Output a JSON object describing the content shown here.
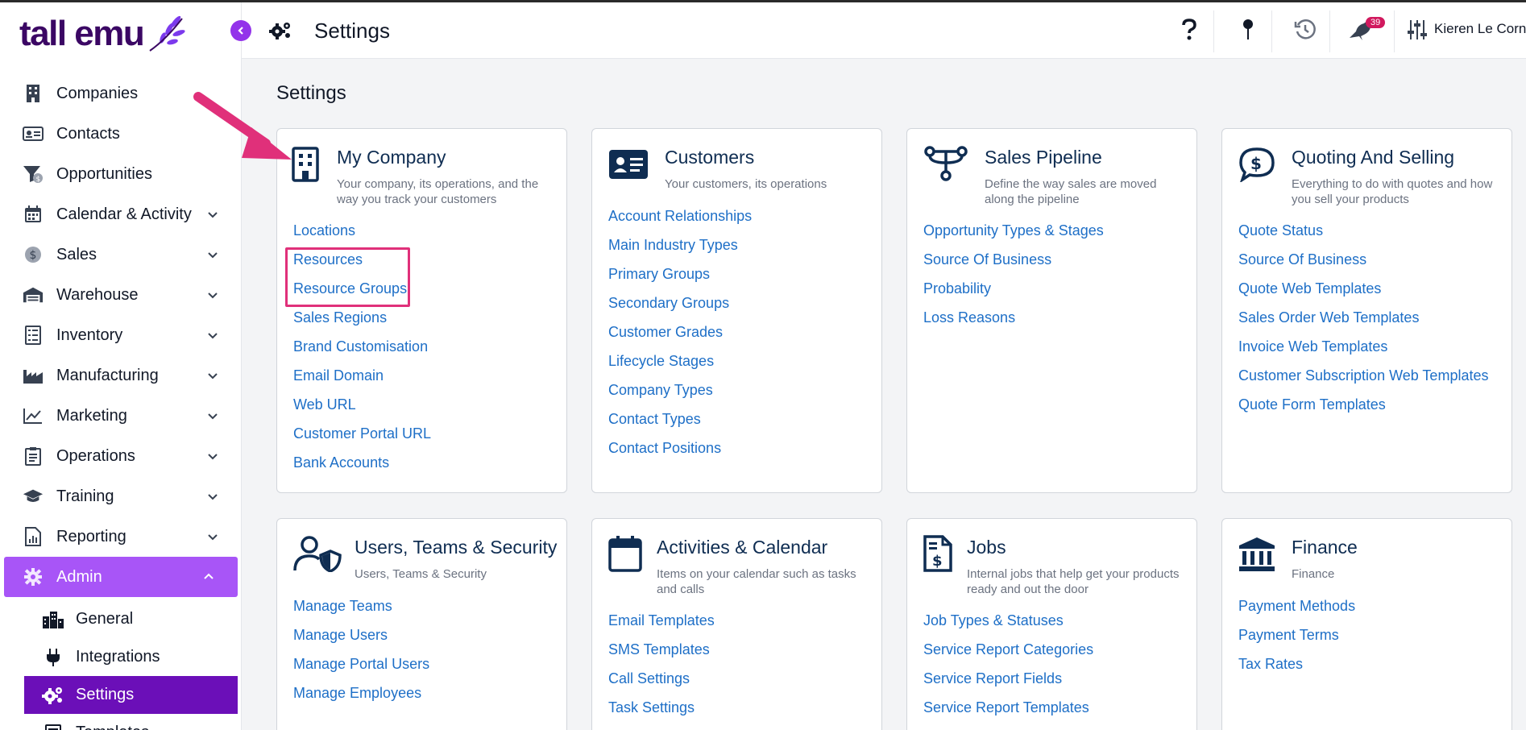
{
  "app": {
    "logo_text": "tall emu",
    "brand_color": "#3b0764",
    "accent_color": "#a855f7"
  },
  "sidebar": {
    "items": [
      {
        "label": "Companies",
        "icon": "building-icon"
      },
      {
        "label": "Contacts",
        "icon": "contact-card-icon"
      },
      {
        "label": "Opportunities",
        "icon": "funnel-icon"
      },
      {
        "label": "Calendar & Activity",
        "icon": "calendar-icon"
      },
      {
        "label": "Sales",
        "icon": "dollar-icon"
      },
      {
        "label": "Warehouse",
        "icon": "warehouse-icon"
      },
      {
        "label": "Inventory",
        "icon": "list-icon"
      },
      {
        "label": "Manufacturing",
        "icon": "factory-icon"
      },
      {
        "label": "Marketing",
        "icon": "chart-line-icon"
      },
      {
        "label": "Operations",
        "icon": "clipboard-icon"
      },
      {
        "label": "Training",
        "icon": "graduation-cap-icon"
      },
      {
        "label": "Reporting",
        "icon": "report-icon"
      },
      {
        "label": "Admin",
        "icon": "cog-icon"
      }
    ],
    "admin_sub": [
      {
        "label": "General",
        "icon": "city-icon"
      },
      {
        "label": "Integrations",
        "icon": "plug-icon"
      },
      {
        "label": "Settings",
        "icon": "cogs-icon"
      },
      {
        "label": "Templates",
        "icon": "template-icon"
      }
    ]
  },
  "topbar": {
    "title": "Settings",
    "notification_count": "39",
    "user_name": "Kieren Le Cornu"
  },
  "main": {
    "heading": "Settings",
    "cards": [
      {
        "title": "My Company",
        "desc": "Your company, its operations, and the way you track your customers",
        "links": [
          "Locations",
          "Resources",
          "Resource Groups",
          "Sales Regions",
          "Brand Customisation",
          "Email Domain",
          "Web URL",
          "Customer Portal URL",
          "Bank Accounts"
        ]
      },
      {
        "title": "Customers",
        "desc": "Your customers, its operations",
        "links": [
          "Account Relationships",
          "Main Industry Types",
          "Primary Groups",
          "Secondary Groups",
          "Customer Grades",
          "Lifecycle Stages",
          "Company Types",
          "Contact Types",
          "Contact Positions"
        ]
      },
      {
        "title": "Sales Pipeline",
        "desc": "Define the way sales are moved along the pipeline",
        "links": [
          "Opportunity Types & Stages",
          "Source Of Business",
          "Probability",
          "Loss Reasons"
        ]
      },
      {
        "title": "Quoting And Selling",
        "desc": "Everything to do with quotes and how you sell your products",
        "links": [
          "Quote Status",
          "Source Of Business",
          "Quote Web Templates",
          "Sales Order Web Templates",
          "Invoice Web Templates",
          "Customer Subscription Web Templates",
          "Quote Form Templates"
        ]
      },
      {
        "title": "Users, Teams & Security",
        "desc": "Users, Teams & Security",
        "links": [
          "Manage Teams",
          "Manage Users",
          "Manage Portal Users",
          "Manage Employees"
        ]
      },
      {
        "title": "Activities & Calendar",
        "desc": "Items on your calendar such as tasks and calls",
        "links": [
          "Email Templates",
          "SMS Templates",
          "Call Settings",
          "Task Settings"
        ]
      },
      {
        "title": "Jobs",
        "desc": "Internal jobs that help get your products ready and out the door",
        "links": [
          "Job Types & Statuses",
          "Service Report Categories",
          "Service Report Fields",
          "Service Report Templates"
        ]
      },
      {
        "title": "Finance",
        "desc": "Finance",
        "links": [
          "Payment Methods",
          "Payment Terms",
          "Tax Rates"
        ]
      }
    ]
  }
}
